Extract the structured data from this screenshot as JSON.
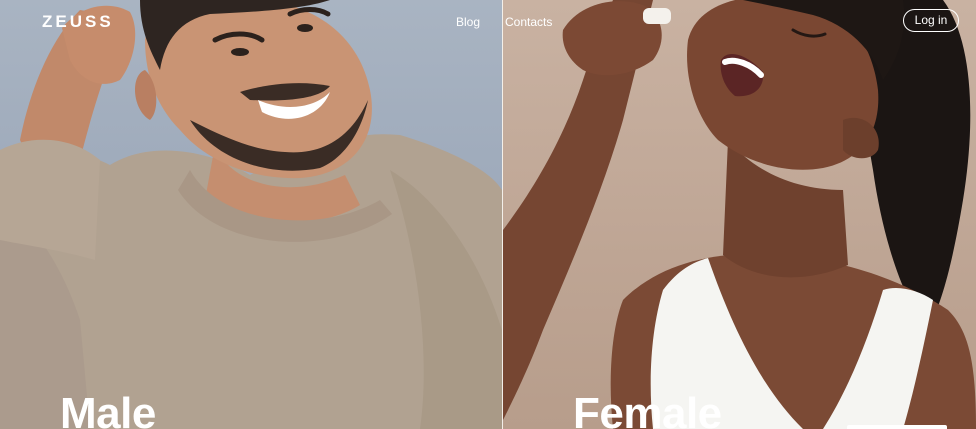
{
  "header": {
    "logo": "ZEUSS",
    "nav": [
      {
        "label": "Blog"
      },
      {
        "label": "Contacts"
      }
    ],
    "login_label": "Log in"
  },
  "categories": [
    {
      "label": "Male"
    },
    {
      "label": "Female"
    }
  ],
  "colors": {
    "left_background": "#a9b4c2",
    "right_background": "#c9b2a2",
    "text": "#ffffff"
  }
}
